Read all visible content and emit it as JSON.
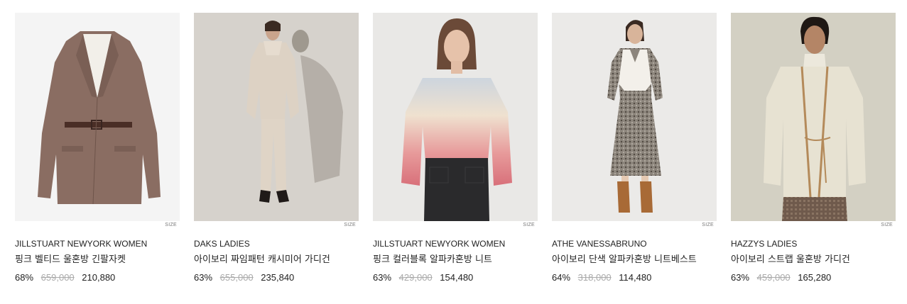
{
  "products": [
    {
      "brand": "JILLSTUART NEWYORK WOMEN",
      "name": "핑크 벨티드 울혼방 긴팔자켓",
      "discount": "68%",
      "original_price": "659,000",
      "price": "210,880",
      "size_label": "SIZE",
      "image": "brown-tweed-belted-jacket"
    },
    {
      "brand": "DAKS LADIES",
      "name": "아이보리 짜임패턴 캐시미어 가디건",
      "discount": "63%",
      "original_price": "655,000",
      "price": "235,840",
      "size_label": "SIZE",
      "image": "model-ivory-cardigan-set"
    },
    {
      "brand": "JILLSTUART NEWYORK WOMEN",
      "name": "핑크 컬러블록 알파카혼방 니트",
      "discount": "63%",
      "original_price": "429,000",
      "price": "154,480",
      "size_label": "SIZE",
      "image": "model-pink-gradient-knit"
    },
    {
      "brand": "ATHE VANESSABRUNO",
      "name": "아이보리 단색 알파카혼방 니트베스트",
      "discount": "64%",
      "original_price": "318,000",
      "price": "114,480",
      "size_label": "SIZE",
      "image": "model-knit-vest-dress"
    },
    {
      "brand": "HAZZYS LADIES",
      "name": "아이보리 스트랩 울혼방 가디건",
      "discount": "63%",
      "original_price": "459,000",
      "price": "165,280",
      "size_label": "SIZE",
      "image": "model-ivory-strap-cardigan"
    }
  ]
}
